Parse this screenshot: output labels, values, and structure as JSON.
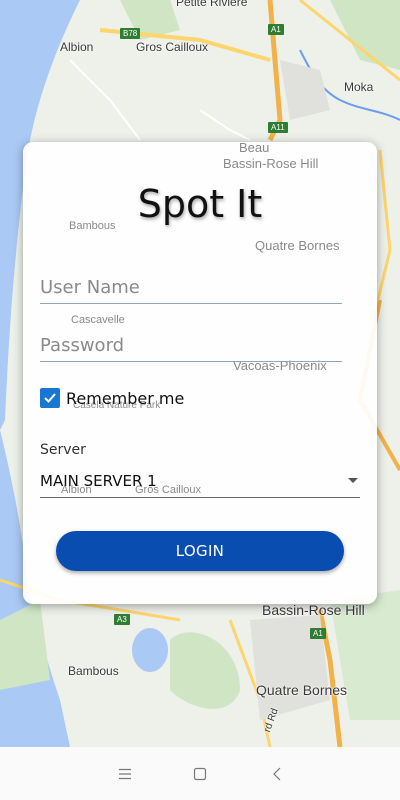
{
  "map": {
    "labels": {
      "petite_riviere": "Petite Riviere",
      "albion_top": "Albion",
      "gros_cailloux_top": "Gros Cailloux",
      "moka": "Moka",
      "bambous_ghost": "Bambous",
      "beau_bassin_top": "Beau",
      "bassin_rose_hill_top": "Bassin-Rose Hill",
      "quatre_bornes_ghost": "Quatre Bornes",
      "cascavelle_ghost": "Cascavelle",
      "vacoas_phoenix_ghost": "Vacoas-Phoenix",
      "casela_ghost": "Casela Nature Park",
      "albion_ghost": "Albion",
      "gros_cailloux_ghost": "Gros Cailloux",
      "bassin_rose_hill_bottom": "Bassin-Rose Hill",
      "bambous_bottom": "Bambous",
      "quatre_bornes_bottom": "Quatre Bornes",
      "rd_fragment": "rd Rd"
    },
    "road_badges": {
      "b78": "B78",
      "a1_top": "A1",
      "a11": "A11",
      "a3": "A3",
      "a1_bottom": "A1"
    },
    "colors": {
      "land": "#eef0ea",
      "water": "#aac9f5",
      "green": "#cfe5c4",
      "road_major": "#f2b24a",
      "road_minor": "#fcd56b"
    }
  },
  "login": {
    "title": "Spot It",
    "username_placeholder": "User Name",
    "password_placeholder": "Password",
    "remember_label": "Remember me",
    "remember_checked": true,
    "server_label": "Server",
    "server_selected": "MAIN SERVER 1",
    "login_button": "LOGIN",
    "accent": "#0a4db0"
  },
  "nav": {
    "icons": [
      "menu-icon",
      "home-square-icon",
      "back-chevron-icon"
    ]
  }
}
